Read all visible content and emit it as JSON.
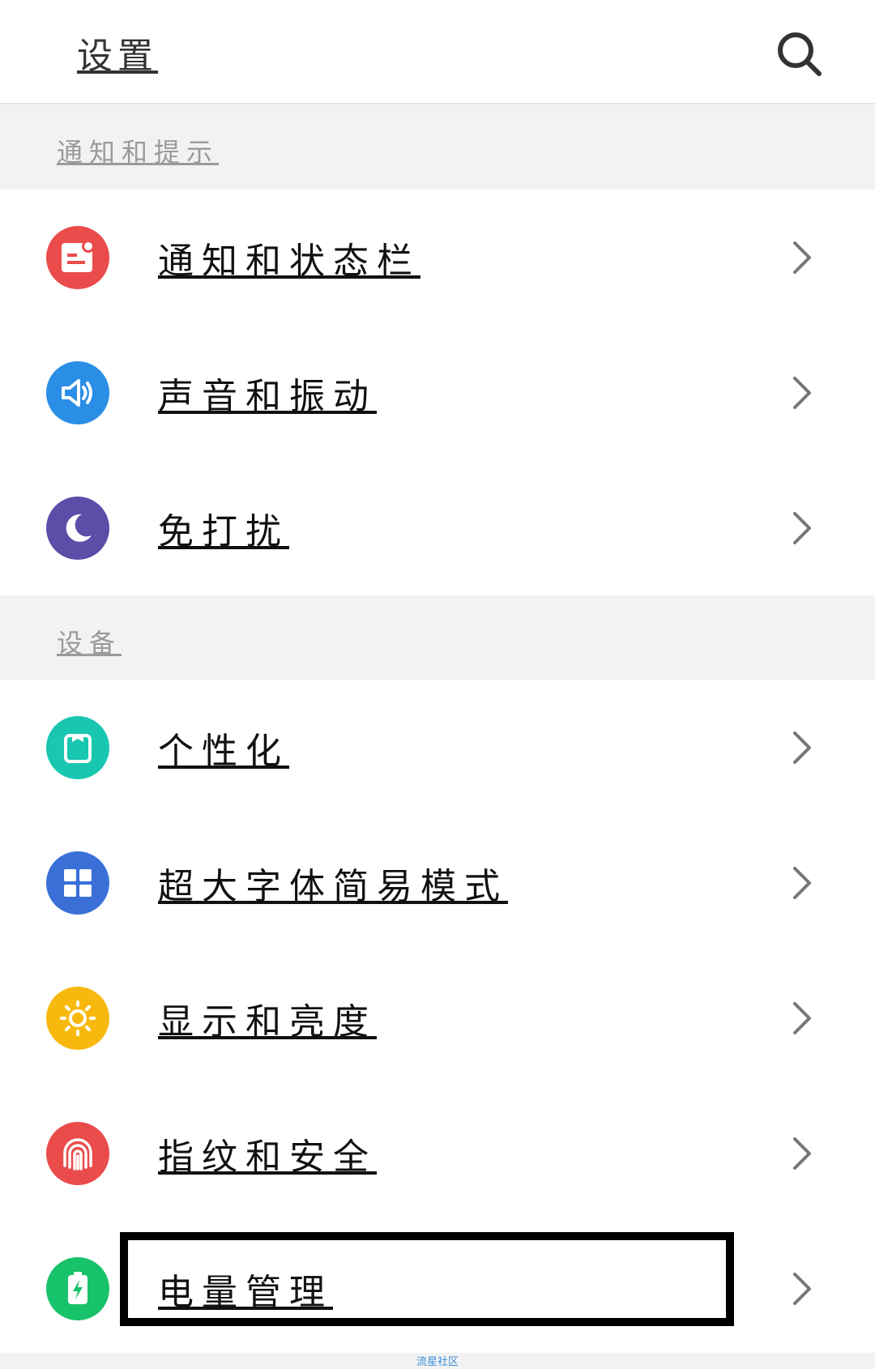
{
  "header": {
    "title": "设置"
  },
  "sections": [
    {
      "label": "通知和提示"
    },
    {
      "label": "设备"
    }
  ],
  "items": [
    {
      "label": "通知和状态栏",
      "icon": "notification-icon",
      "color": "#ea4b4b"
    },
    {
      "label": "声音和振动",
      "icon": "speaker-icon",
      "color": "#2a8ee6"
    },
    {
      "label": "免打扰",
      "icon": "moon-icon",
      "color": "#5b4da8"
    },
    {
      "label": "个性化",
      "icon": "personalization-icon",
      "color": "#19c7b0"
    },
    {
      "label": "超大字体简易模式",
      "icon": "grid-icon",
      "color": "#3a6fd8"
    },
    {
      "label": "显示和亮度",
      "icon": "sun-icon",
      "color": "#f8b90f"
    },
    {
      "label": "指纹和安全",
      "icon": "fingerprint-icon",
      "color": "#ea4b4b"
    },
    {
      "label": "电量管理",
      "icon": "battery-icon",
      "color": "#18c26a"
    }
  ],
  "watermark": "流星社区"
}
